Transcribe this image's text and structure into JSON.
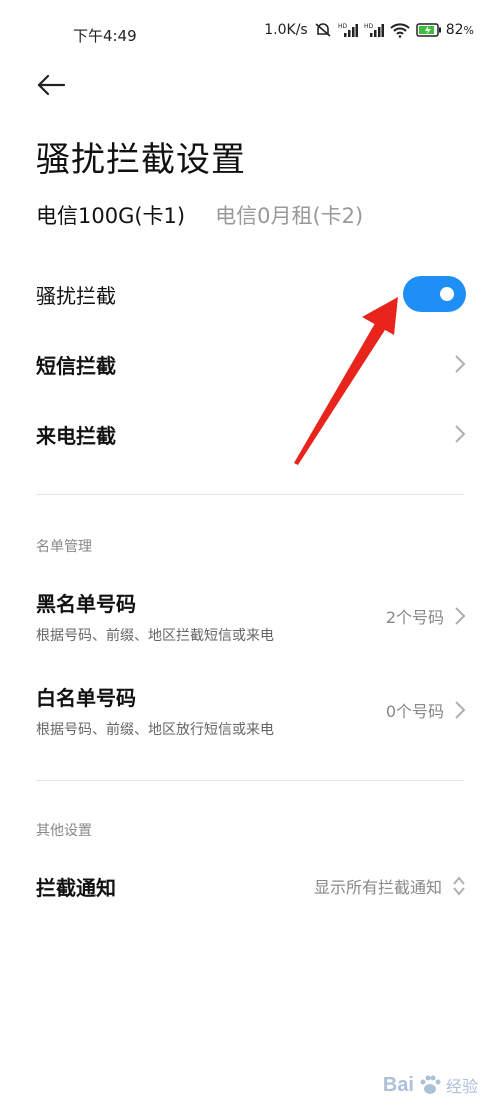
{
  "status": {
    "time": "下午4:49",
    "speed": "1.0K/s",
    "battery": "82"
  },
  "icons": {
    "back": "back-arrow-icon",
    "chevron": "chevron-right-icon",
    "updown": "chevron-updown-icon"
  },
  "title": "骚扰拦截设置",
  "sim_tabs": [
    "电信100G(卡1)",
    "电信0月租(卡2)"
  ],
  "rows": {
    "intercept": {
      "label": "骚扰拦截",
      "enabled": true
    },
    "sms": {
      "label": "短信拦截"
    },
    "call": {
      "label": "来电拦截"
    }
  },
  "list_section": {
    "label": "名单管理",
    "blacklist": {
      "title": "黑名单号码",
      "subtitle": "根据号码、前缀、地区拦截短信或来电",
      "value": "2个号码"
    },
    "whitelist": {
      "title": "白名单号码",
      "subtitle": "根据号码、前缀、地区放行短信或来电",
      "value": "0个号码"
    }
  },
  "other_section": {
    "label": "其他设置",
    "notify": {
      "title": "拦截通知",
      "value": "显示所有拦截通知"
    }
  },
  "watermark": {
    "brand": "Bai",
    "sub": "经验"
  },
  "colors": {
    "accent": "#1f8ef5",
    "arrow": "#e8241c"
  }
}
